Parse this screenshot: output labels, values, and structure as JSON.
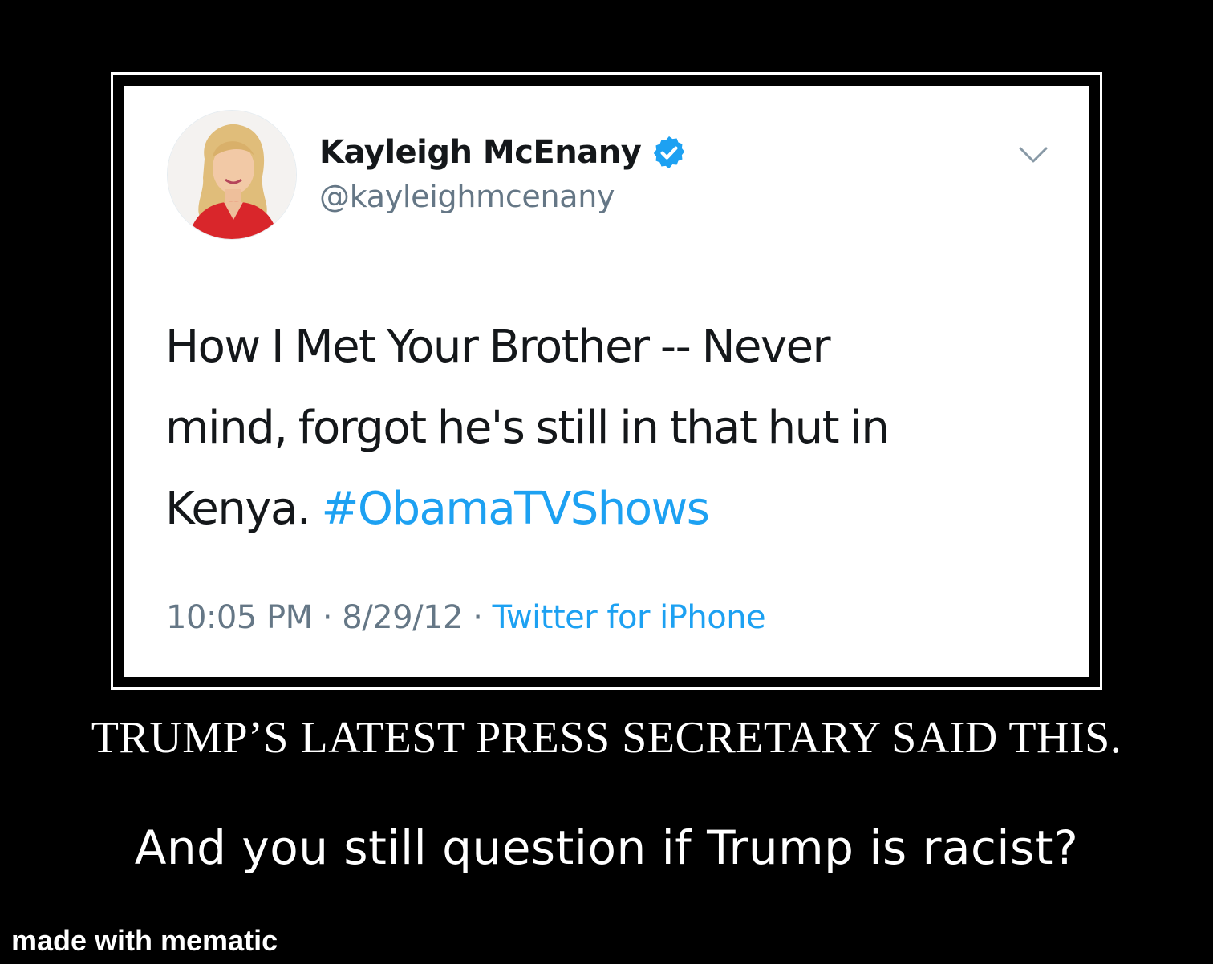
{
  "tweet": {
    "display_name": "Kayleigh McEnany",
    "handle": "@kayleighmcenany",
    "verified": true,
    "text_line_1": "How I Met Your Brother -- Never",
    "text_line_2": "mind, forgot he's still in that hut in",
    "text_line_3": "Kenya.",
    "hashtag": "#ObamaTVShows",
    "time": "10:05 PM",
    "separator": "·",
    "date": "8/29/12",
    "source": "Twitter for iPhone",
    "icons": {
      "avatar": "profile-photo",
      "verified": "verified-badge-icon",
      "menu": "chevron-down-icon"
    },
    "colors": {
      "link": "#1da1f2",
      "text": "#14171a",
      "secondary": "#657786"
    }
  },
  "caption": {
    "title": "TRUMP’S LATEST PRESS SECRETARY SAID THIS.",
    "subtitle": "And you still question if Trump is racist?"
  },
  "watermark": "made with mematic"
}
